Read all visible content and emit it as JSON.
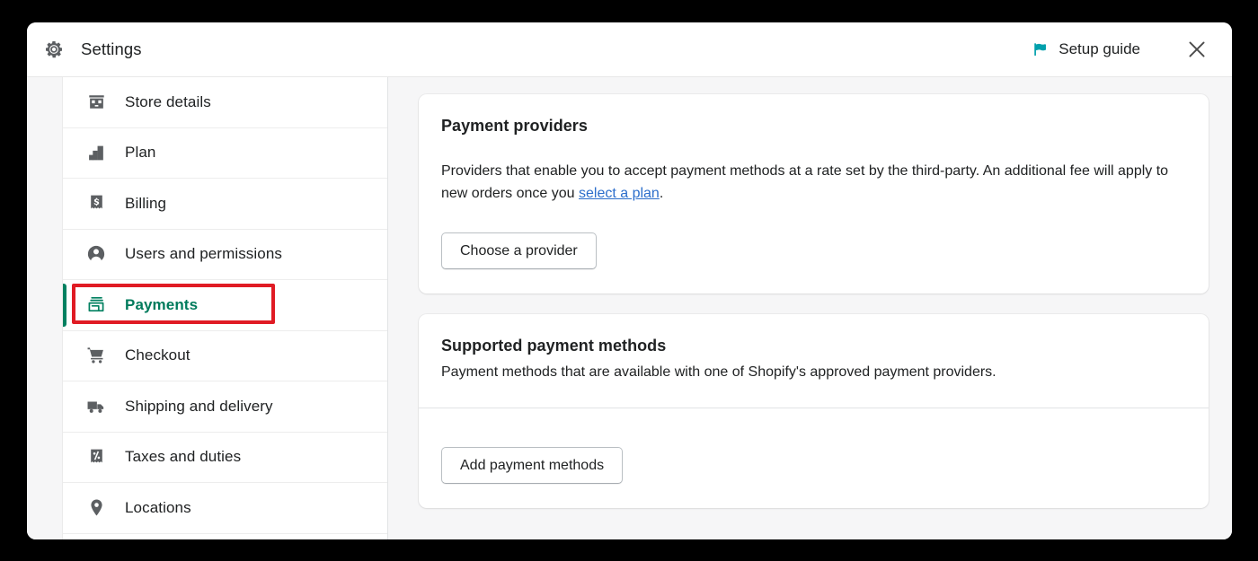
{
  "header": {
    "title": "Settings",
    "gear_icon": "gear-icon",
    "setup_guide_label": "Setup guide",
    "flag_icon": "flag-icon",
    "close_icon": "close-icon",
    "flag_color": "#00a0ac"
  },
  "sidebar": {
    "selected": "Payments",
    "accent_color": "#008060",
    "annotation_color": "#e01b24",
    "items": [
      {
        "label": "Store details",
        "icon": "storefront-icon",
        "selected": false
      },
      {
        "label": "Plan",
        "icon": "plan-blocks-icon",
        "selected": false
      },
      {
        "label": "Billing",
        "icon": "billing-receipt-icon",
        "selected": false
      },
      {
        "label": "Users and permissions",
        "icon": "user-icon",
        "selected": false
      },
      {
        "label": "Payments",
        "icon": "payments-icon",
        "selected": true
      },
      {
        "label": "Checkout",
        "icon": "cart-icon",
        "selected": false
      },
      {
        "label": "Shipping and delivery",
        "icon": "truck-icon",
        "selected": false
      },
      {
        "label": "Taxes and duties",
        "icon": "percent-receipt-icon",
        "selected": false
      },
      {
        "label": "Locations",
        "icon": "map-pin-icon",
        "selected": false
      }
    ]
  },
  "content": {
    "providers_card": {
      "title": "Payment providers",
      "desc_before_link": "Providers that enable you to accept payment methods at a rate set by the third-party. An additional fee will apply to new orders once you ",
      "link_text": "select a plan",
      "desc_after_link": ".",
      "button_label": "Choose a provider"
    },
    "methods_card": {
      "title": "Supported payment methods",
      "description": "Payment methods that are available with one of Shopify's approved payment providers.",
      "button_label": "Add payment methods"
    }
  }
}
